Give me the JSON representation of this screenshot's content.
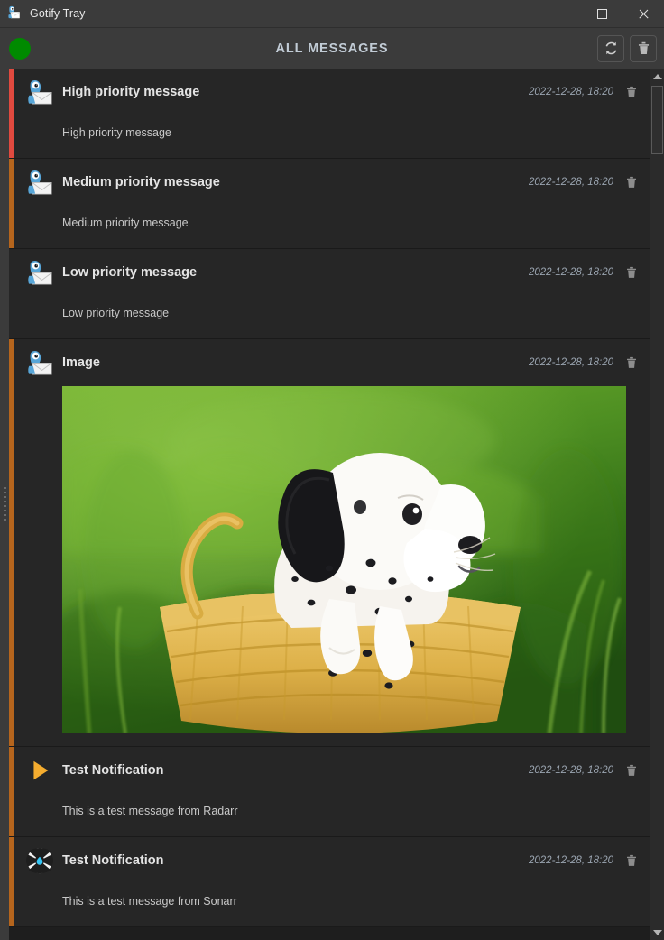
{
  "window": {
    "title": "Gotify Tray",
    "icon": "gotify-logo-icon",
    "minimize_label": "Minimize",
    "maximize_label": "Maximize",
    "close_label": "Close"
  },
  "header": {
    "title": "ALL MESSAGES",
    "status": {
      "name": "connection-status-indicator",
      "color": "#008a00",
      "state": "connected"
    },
    "actions": [
      {
        "name": "refresh-button",
        "icon": "refresh-icon",
        "label": "Refresh"
      },
      {
        "name": "delete-all-button",
        "icon": "trash-icon",
        "label": "Delete all"
      }
    ]
  },
  "colors": {
    "priority_high": "#e04a3f",
    "priority_medium": "#b5651d",
    "priority_low": "#262626",
    "accent_text": "#c2ccd6",
    "background": "#1e1e1e",
    "message_background": "#262626",
    "chrome": "#3b3b3b"
  },
  "messages": [
    {
      "title": "High priority message",
      "body": "High priority message",
      "date": "2022-12-28, 18:20",
      "priority": "high",
      "priority_color": "#e04a3f",
      "icon": "gotify-logo-icon",
      "has_image": false,
      "delete_label": "Delete message"
    },
    {
      "title": "Medium priority message",
      "body": "Medium priority message",
      "date": "2022-12-28, 18:20",
      "priority": "medium",
      "priority_color": "#b5651d",
      "icon": "gotify-logo-icon",
      "has_image": false,
      "delete_label": "Delete message"
    },
    {
      "title": "Low priority message",
      "body": "Low priority message",
      "date": "2022-12-28, 18:20",
      "priority": "low",
      "priority_color": "#262626",
      "icon": "gotify-logo-icon",
      "has_image": false,
      "delete_label": "Delete message"
    },
    {
      "title": "Image",
      "body": "",
      "date": "2022-12-28, 18:20",
      "priority": "medium",
      "priority_color": "#b5651d",
      "icon": "gotify-logo-icon",
      "has_image": true,
      "image_alt": "Dalmatian puppy sitting in a wicker basket on green grass",
      "delete_label": "Delete message"
    },
    {
      "title": "Test Notification",
      "body": "This is a test message from Radarr",
      "date": "2022-12-28, 18:20",
      "priority": "medium",
      "priority_color": "#b5651d",
      "icon": "radarr-logo-icon",
      "has_image": false,
      "delete_label": "Delete message"
    },
    {
      "title": "Test Notification",
      "body": "This is a test message from Sonarr",
      "date": "2022-12-28, 18:20",
      "priority": "medium",
      "priority_color": "#b5651d",
      "icon": "sonarr-logo-icon",
      "has_image": false,
      "delete_label": "Delete message"
    }
  ],
  "scrollbar": {
    "name": "messages-scrollbar",
    "up_label": "Scroll up",
    "down_label": "Scroll down",
    "thumb_label": "Scroll thumb"
  }
}
